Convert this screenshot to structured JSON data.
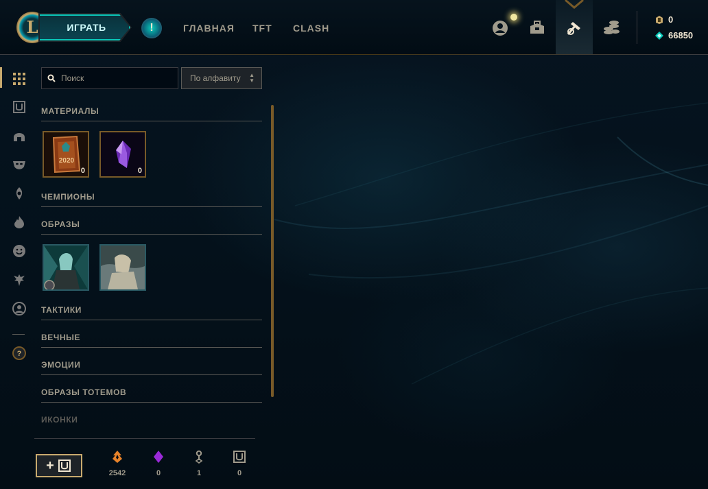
{
  "nav": {
    "play_label": "ИГРАТЬ",
    "alert_label": "!",
    "items": [
      {
        "label": "ГЛАВНАЯ"
      },
      {
        "label": "TFT"
      },
      {
        "label": "CLASH"
      }
    ],
    "icons": [
      "profile-icon",
      "collection-icon",
      "loot-icon",
      "store-icon"
    ],
    "active_icon": "loot-icon"
  },
  "wallet": {
    "rp": "0",
    "blue_essence": "66850"
  },
  "rail": {
    "items": [
      "all-icon",
      "chest-icon",
      "helmet-icon",
      "mask-icon",
      "ward-icon",
      "flame-icon",
      "emote-icon",
      "totem-icon",
      "avatar-icon"
    ],
    "help_label": "?",
    "active": "all-icon"
  },
  "search": {
    "placeholder": "Поиск"
  },
  "sort": {
    "selected": "По алфавиту"
  },
  "sections": [
    {
      "title": "МАТЕРИАЛЫ"
    },
    {
      "title": "ЧЕМПИОНЫ"
    },
    {
      "title": "ОБРАЗЫ"
    },
    {
      "title": "ТАКТИКИ"
    },
    {
      "title": "ВЕЧНЫЕ"
    },
    {
      "title": "ЭМОЦИИ"
    },
    {
      "title": "ОБРАЗЫ ТОТЕМОВ"
    },
    {
      "title": "ИКОНКИ"
    }
  ],
  "materials": [
    {
      "name": "2020-capsule",
      "year": "2020",
      "count": "0"
    },
    {
      "name": "mythic-essence",
      "count": "0"
    }
  ],
  "skins": [
    {
      "name": "skin-shard-1"
    },
    {
      "name": "skin-shard-2"
    }
  ],
  "bottom": {
    "craft_label": "+",
    "resources": [
      {
        "icon": "orange-essence-icon",
        "value": "2542"
      },
      {
        "icon": "mythic-essence-icon",
        "value": "0"
      },
      {
        "icon": "key-icon",
        "value": "1"
      },
      {
        "icon": "chest-icon",
        "value": "0"
      }
    ]
  },
  "colors": {
    "gold": "#c8aa6e",
    "teal": "#0ac8b9",
    "text": "#a09b8c",
    "background": "#010a13"
  }
}
